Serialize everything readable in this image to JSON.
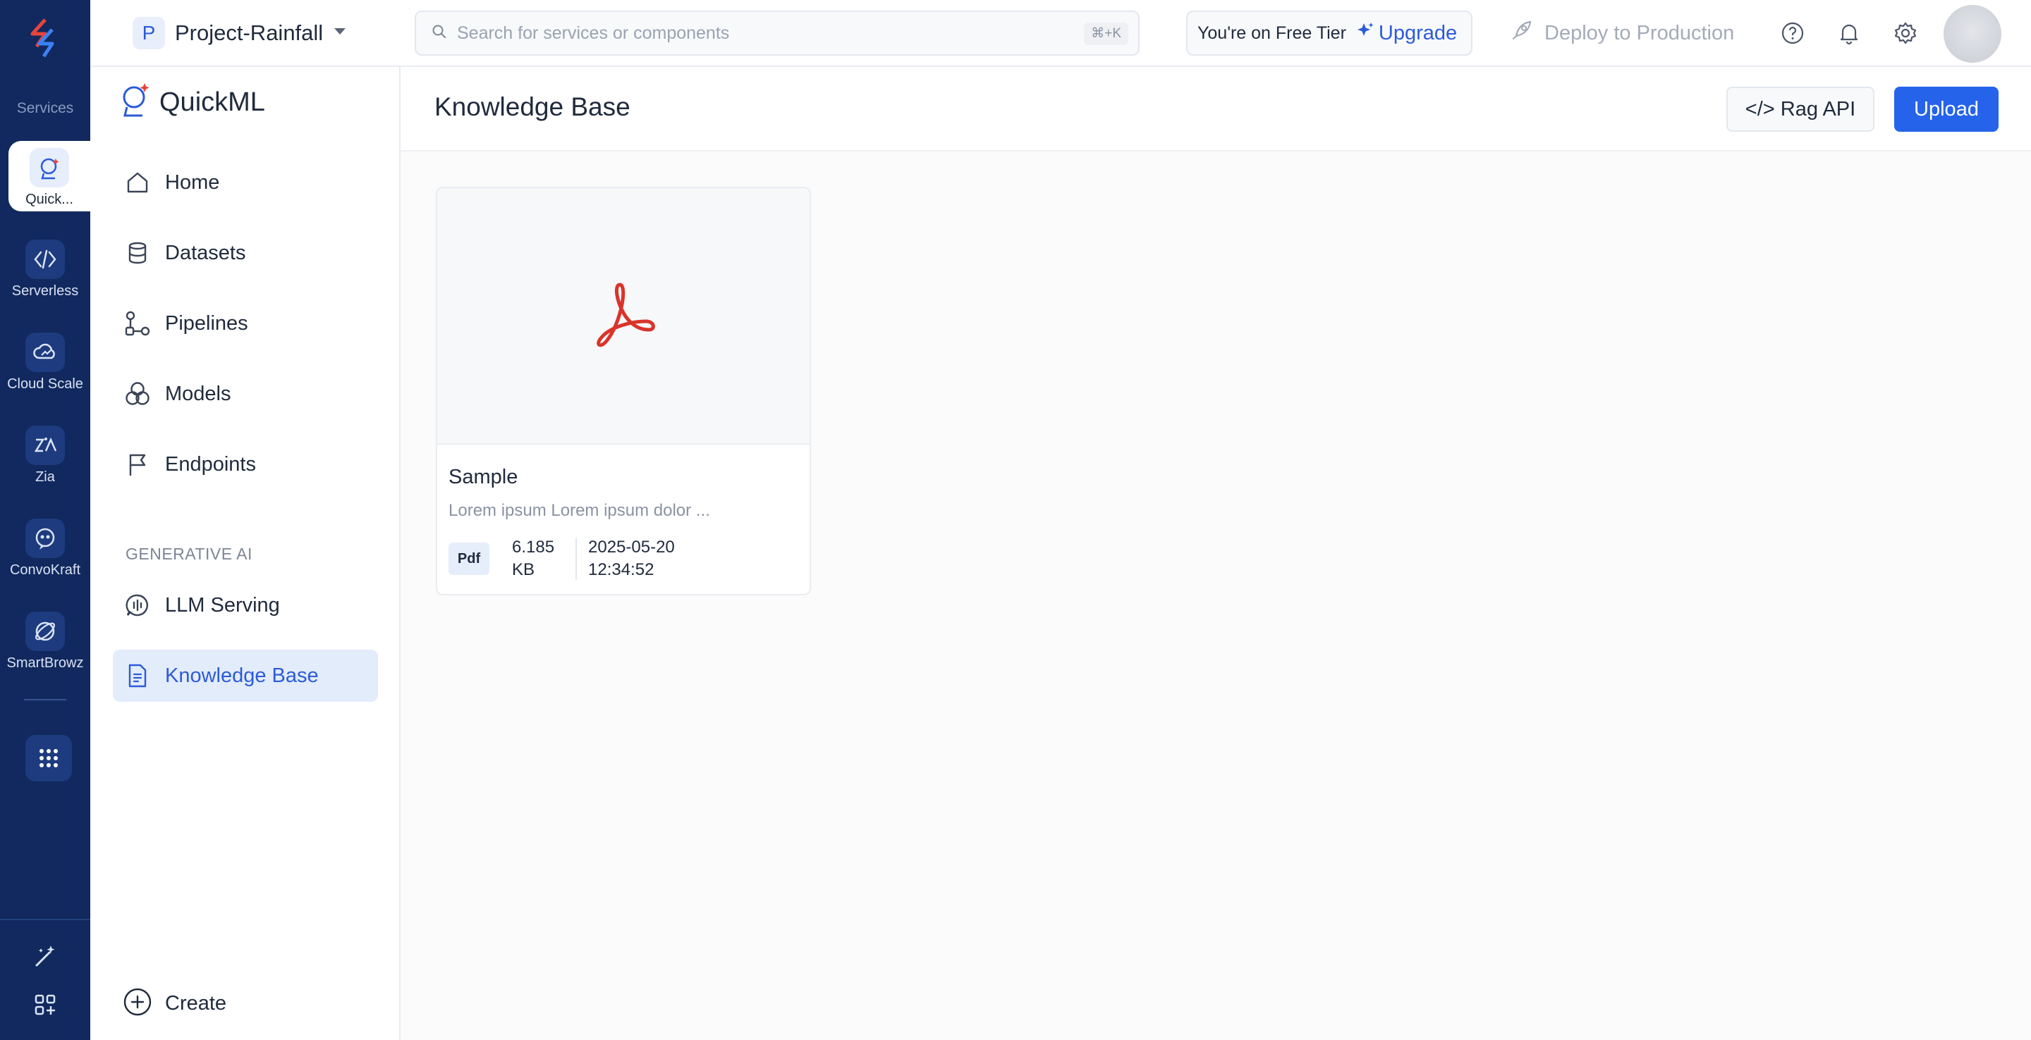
{
  "rail": {
    "title": "Services",
    "items": [
      {
        "label": "Quick..."
      },
      {
        "label": "Serverless"
      },
      {
        "label": "Cloud Scale"
      },
      {
        "label": "Zia"
      },
      {
        "label": "ConvoKraft"
      },
      {
        "label": "SmartBrowz"
      }
    ]
  },
  "topbar": {
    "project_initial": "P",
    "project_name": "Project-Rainfall",
    "search_placeholder": "Search for services or components",
    "search_shortcut": "⌘+K",
    "tier_text": "You're on Free Tier",
    "upgrade_label": "Upgrade",
    "deploy_label": "Deploy to Production"
  },
  "sidebar": {
    "brand": "QuickML",
    "items": [
      {
        "label": "Home"
      },
      {
        "label": "Datasets"
      },
      {
        "label": "Pipelines"
      },
      {
        "label": "Models"
      },
      {
        "label": "Endpoints"
      }
    ],
    "section_title": "GENERATIVE AI",
    "gen_items": [
      {
        "label": "LLM Serving"
      },
      {
        "label": "Knowledge Base"
      }
    ],
    "create_label": "Create"
  },
  "main": {
    "title": "Knowledge Base",
    "rag_api_label": "</> Rag API",
    "upload_label": "Upload",
    "documents": [
      {
        "title": "Sample",
        "description": "Lorem ipsum Lorem ipsum dolor ...",
        "type": "Pdf",
        "size_value": "6.185",
        "size_unit": "KB",
        "date": "2025-05-20",
        "time": "12:34:52"
      }
    ]
  },
  "colors": {
    "rail_bg": "#11295e",
    "accent": "#2563eb",
    "pdf_red": "#d9342b"
  }
}
